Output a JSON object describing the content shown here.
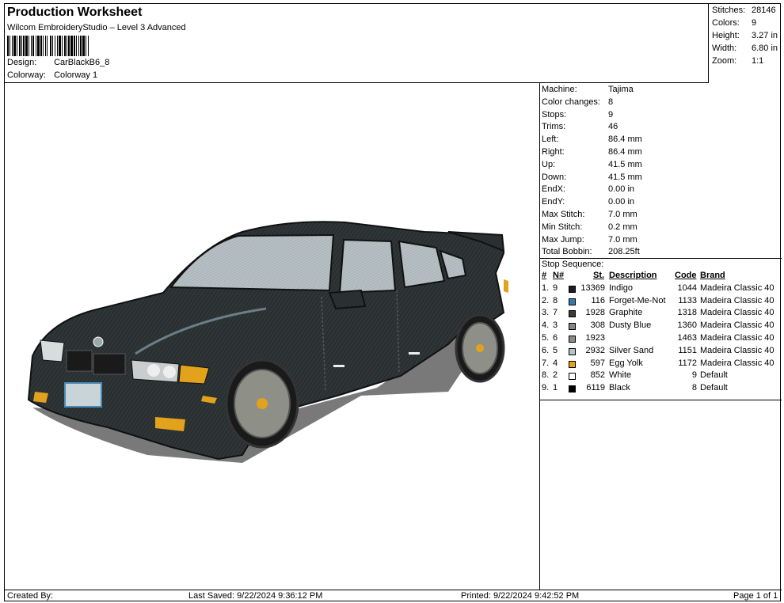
{
  "header": {
    "title": "Production Worksheet",
    "subtitle": "Wilcom EmbroideryStudio – Level 3 Advanced",
    "design_label": "Design:",
    "design_value": "CarBlackB6_8",
    "colorway_label": "Colorway:",
    "colorway_value": "Colorway 1"
  },
  "summary": {
    "stitches_label": "Stitches:",
    "stitches_value": "28146",
    "colors_label": "Colors:",
    "colors_value": "9",
    "height_label": "Height:",
    "height_value": "3.27 in",
    "width_label": "Width:",
    "width_value": "6.80 in",
    "zoom_label": "Zoom:",
    "zoom_value": "1:1"
  },
  "machine_info": [
    {
      "label": "Machine:",
      "value": "Tajima"
    },
    {
      "label": "Color changes:",
      "value": "8"
    },
    {
      "label": "Stops:",
      "value": "9"
    },
    {
      "label": "Trims:",
      "value": "46"
    },
    {
      "label": "Left:",
      "value": "86.4 mm"
    },
    {
      "label": "Right:",
      "value": "86.4 mm"
    },
    {
      "label": "Up:",
      "value": "41.5 mm"
    },
    {
      "label": "Down:",
      "value": "41.5 mm"
    },
    {
      "label": "EndX:",
      "value": "0.00 in"
    },
    {
      "label": "EndY:",
      "value": "0.00 in"
    },
    {
      "label": "Max Stitch:",
      "value": "7.0 mm"
    },
    {
      "label": "Min Stitch:",
      "value": "0.2 mm"
    },
    {
      "label": "Max Jump:",
      "value": "7.0 mm"
    },
    {
      "label": "Total Bobbin:",
      "value": "208.25ft"
    }
  ],
  "stop_sequence": {
    "title": "Stop Sequence:",
    "headers": {
      "idx": "#",
      "n": "N#",
      "st": "St.",
      "desc": "Description",
      "code": "Code",
      "brand": "Brand"
    },
    "rows": [
      {
        "idx": "1.",
        "n": "9",
        "color": "#1c1c22",
        "st": "13369",
        "desc": "Indigo",
        "code": "1044",
        "brand": "Madeira Classic 40"
      },
      {
        "idx": "2.",
        "n": "8",
        "color": "#3b78a8",
        "st": "116",
        "desc": "Forget-Me-Not",
        "code": "1133",
        "brand": "Madeira Classic 40"
      },
      {
        "idx": "3.",
        "n": "7",
        "color": "#3a3b3d",
        "st": "1928",
        "desc": "Graphite",
        "code": "1318",
        "brand": "Madeira Classic 40"
      },
      {
        "idx": "4.",
        "n": "3",
        "color": "#7d8891",
        "st": "308",
        "desc": "Dusty Blue",
        "code": "1360",
        "brand": "Madeira Classic 40"
      },
      {
        "idx": "5.",
        "n": "6",
        "color": "#8a8a8a",
        "st": "1923",
        "desc": "",
        "code": "1463",
        "brand": "Madeira Classic 40"
      },
      {
        "idx": "6.",
        "n": "5",
        "color": "#b8c3c8",
        "st": "2932",
        "desc": "Silver Sand",
        "code": "1151",
        "brand": "Madeira Classic 40"
      },
      {
        "idx": "7.",
        "n": "4",
        "color": "#e2a21c",
        "st": "597",
        "desc": "Egg Yolk",
        "code": "1172",
        "brand": "Madeira Classic 40"
      },
      {
        "idx": "8.",
        "n": "2",
        "color": "#ffffff",
        "st": "852",
        "desc": "White",
        "code": "9",
        "brand": "Default"
      },
      {
        "idx": "9.",
        "n": "1",
        "color": "#000000",
        "st": "6119",
        "desc": "Black",
        "code": "8",
        "brand": "Default"
      }
    ]
  },
  "footer": {
    "created": "Created By:",
    "saved": "Last Saved: 9/22/2024 9:36:12 PM",
    "printed": "Printed: 9/22/2024 9:42:52 PM",
    "page": "Page 1 of 1"
  }
}
